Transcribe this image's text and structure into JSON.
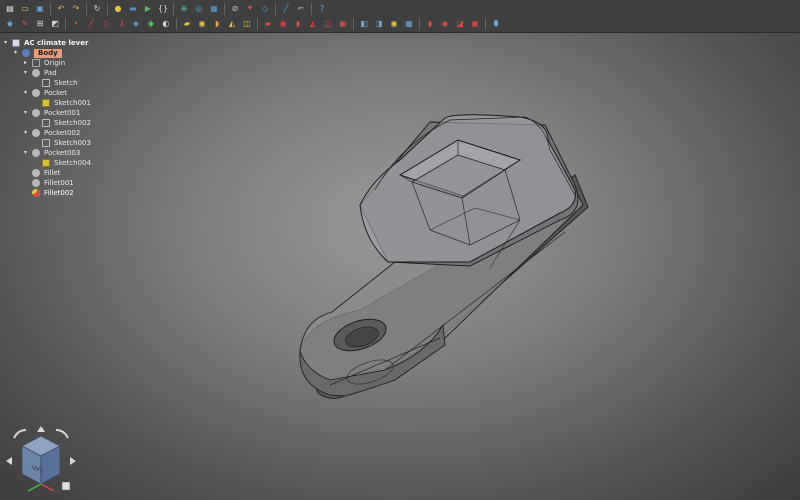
{
  "toolbar": {
    "row1": [
      {
        "name": "new-document-icon",
        "glyph": "▤",
        "color": "#f0f0f0"
      },
      {
        "name": "open-folder-icon",
        "glyph": "▭",
        "color": "#e6c75a"
      },
      {
        "name": "save-icon",
        "glyph": "▣",
        "color": "#6fa0d8"
      },
      {
        "sep": true
      },
      {
        "name": "undo-icon",
        "glyph": "↶",
        "color": "#e7b84d"
      },
      {
        "name": "redo-icon",
        "glyph": "↷",
        "color": "#e7b84d"
      },
      {
        "sep": true
      },
      {
        "name": "refresh-icon",
        "glyph": "↻",
        "color": "#d8d8d8"
      },
      {
        "sep": true
      },
      {
        "name": "macro-icon",
        "glyph": "●",
        "color": "#e5c542"
      },
      {
        "name": "macro-edit-icon",
        "glyph": "▬",
        "color": "#5a8ed0"
      },
      {
        "name": "macro-run-icon",
        "glyph": "▶",
        "color": "#58b85e"
      },
      {
        "name": "macro-code-icon",
        "glyph": "{}",
        "color": "#d8d8d8"
      },
      {
        "sep": true
      },
      {
        "name": "fit-all-icon",
        "glyph": "⊕",
        "color": "#4fc0b0"
      },
      {
        "name": "zoom-icon",
        "glyph": "◎",
        "color": "#4aa5d8"
      },
      {
        "name": "view-box-icon",
        "glyph": "▦",
        "color": "#5a9fd8"
      },
      {
        "sep": true
      },
      {
        "name": "no-draw-style-icon",
        "glyph": "⊘",
        "color": "#d0d0d0"
      },
      {
        "name": "selection-icon",
        "glyph": "⯆",
        "color": "#d85050"
      },
      {
        "name": "measure-icon",
        "glyph": "◇",
        "color": "#4aa5d8"
      },
      {
        "sep": true
      },
      {
        "name": "ruler-icon",
        "glyph": "╱",
        "color": "#4aa5d8"
      },
      {
        "name": "clipping-icon",
        "glyph": "⌐",
        "color": "#d8d8d8"
      },
      {
        "sep": true
      },
      {
        "name": "help-icon",
        "glyph": "?",
        "color": "#6aa5d8"
      }
    ],
    "row2": [
      {
        "name": "part-design-workbench-icon",
        "glyph": "◆",
        "color": "#5a9fd8"
      },
      {
        "name": "open-sketch-icon",
        "glyph": "✎",
        "color": "#d85050"
      },
      {
        "name": "create-sketch-icon",
        "glyph": "⊞",
        "color": "#d8d8d8"
      },
      {
        "name": "body-icon",
        "glyph": "◩",
        "color": "#d8d8d8"
      },
      {
        "sep": true
      },
      {
        "name": "point-icon",
        "glyph": "•",
        "color": "#e05050"
      },
      {
        "name": "line-icon",
        "glyph": "╱",
        "color": "#e05050"
      },
      {
        "name": "plane-icon",
        "glyph": "◇",
        "color": "#e05050"
      },
      {
        "name": "local-coordinate-system-icon",
        "glyph": "⅃",
        "color": "#e05050"
      },
      {
        "name": "shape-binder-icon",
        "glyph": "◈",
        "color": "#6aa5d8"
      },
      {
        "name": "clone-icon",
        "glyph": "◆",
        "color": "#4fc050"
      },
      {
        "name": "sub-shape-binder-icon",
        "glyph": "◐",
        "color": "#d8d8d8"
      },
      {
        "sep": true
      },
      {
        "name": "pad-icon",
        "glyph": "▰",
        "color": "#e5c542"
      },
      {
        "name": "revolution-icon",
        "glyph": "◉",
        "color": "#e5c542"
      },
      {
        "name": "additive-loft-icon",
        "glyph": "◗",
        "color": "#e5a542"
      },
      {
        "name": "additive-pipe-icon",
        "glyph": "◭",
        "color": "#e5c542"
      },
      {
        "name": "additive-helix-icon",
        "glyph": "◫",
        "color": "#e5c542"
      },
      {
        "sep": true
      },
      {
        "name": "pocket-icon",
        "glyph": "▰",
        "color": "#d84848"
      },
      {
        "name": "hole-icon",
        "glyph": "◉",
        "color": "#d84848"
      },
      {
        "name": "groove-icon",
        "glyph": "◗",
        "color": "#d84848"
      },
      {
        "name": "subtractive-loft-icon",
        "glyph": "◭",
        "color": "#d84848"
      },
      {
        "name": "subtractive-pipe-icon",
        "glyph": "◫",
        "color": "#d84848"
      },
      {
        "name": "subtractive-helix-icon",
        "glyph": "▣",
        "color": "#d84848"
      },
      {
        "sep": true
      },
      {
        "name": "mirrored-icon",
        "glyph": "◧",
        "color": "#6aa5d8"
      },
      {
        "name": "linear-pattern-icon",
        "glyph": "◨",
        "color": "#6aa5d8"
      },
      {
        "name": "polar-pattern-icon",
        "glyph": "◉",
        "color": "#e5c542"
      },
      {
        "name": "multi-transform-icon",
        "glyph": "▦",
        "color": "#6aa5d8"
      },
      {
        "sep": true
      },
      {
        "name": "fillet-icon",
        "glyph": "◗",
        "color": "#d84848"
      },
      {
        "name": "chamfer-icon",
        "glyph": "◆",
        "color": "#d84848"
      },
      {
        "name": "draft-icon",
        "glyph": "◪",
        "color": "#d84848"
      },
      {
        "name": "thickness-icon",
        "glyph": "▣",
        "color": "#d84848"
      },
      {
        "sep": true
      },
      {
        "name": "boolean-icon",
        "glyph": "⬮",
        "color": "#6aa5d8"
      }
    ]
  },
  "tree": [
    {
      "label": "AC climate lever",
      "depth": 0,
      "twisty": "▾",
      "icon": "document",
      "kind": "root"
    },
    {
      "label": "Body",
      "depth": 1,
      "twisty": "▾",
      "icon": "body",
      "kind": "selected"
    },
    {
      "label": "Origin",
      "depth": 2,
      "twisty": "▸",
      "icon": "origin"
    },
    {
      "label": "Pad",
      "depth": 2,
      "twisty": "▾",
      "icon": "feature"
    },
    {
      "label": "Sketch",
      "depth": 3,
      "twisty": "",
      "icon": "sketch"
    },
    {
      "label": "Pocket",
      "depth": 2,
      "twisty": "▾",
      "icon": "feature"
    },
    {
      "label": "Sketch001",
      "depth": 3,
      "twisty": "",
      "icon": "sketch-yellow"
    },
    {
      "label": "Pocket001",
      "depth": 2,
      "twisty": "▾",
      "icon": "feature"
    },
    {
      "label": "Sketch002",
      "depth": 3,
      "twisty": "",
      "icon": "sketch"
    },
    {
      "label": "Pocket002",
      "depth": 2,
      "twisty": "▾",
      "icon": "feature"
    },
    {
      "label": "Sketch003",
      "depth": 3,
      "twisty": "",
      "icon": "sketch"
    },
    {
      "label": "Pocket003",
      "depth": 2,
      "twisty": "▾",
      "icon": "feature"
    },
    {
      "label": "Sketch004",
      "depth": 3,
      "twisty": "",
      "icon": "sketch-yellow"
    },
    {
      "label": "Fillet",
      "depth": 2,
      "twisty": "",
      "icon": "feature"
    },
    {
      "label": "Fillet001",
      "depth": 2,
      "twisty": "",
      "icon": "feature"
    },
    {
      "label": "Fillet002",
      "depth": 2,
      "twisty": "",
      "icon": "tip",
      "kind": "highlight"
    }
  ],
  "navcube": {
    "face_label": "LEFT"
  },
  "colors": {
    "toolbar_bg": "#3f3f3f",
    "selected_item": "#e79a7c",
    "part_face": "#8e8e92",
    "edge": "#1a1a1a",
    "navcube": "#6d86a8"
  }
}
